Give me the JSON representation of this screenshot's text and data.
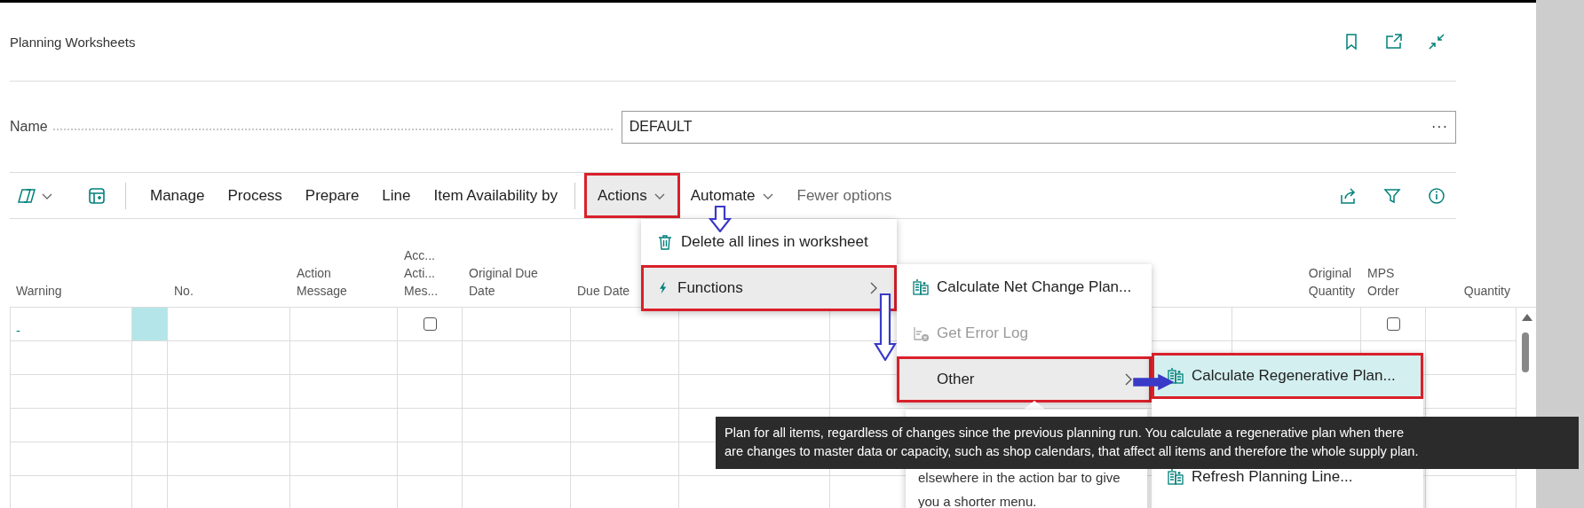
{
  "page": {
    "title": "Planning Worksheets"
  },
  "name_field": {
    "label": "Name",
    "value": "DEFAULT",
    "more": "···"
  },
  "toolbar": {
    "groups": [
      "Manage",
      "Process",
      "Prepare",
      "Line",
      "Item Availability by"
    ],
    "menus": [
      {
        "label": "Actions",
        "selected": true,
        "marked": true
      },
      {
        "label": "Automate",
        "selected": false,
        "marked": false
      }
    ],
    "fewer": "Fewer options"
  },
  "table": {
    "columns": [
      {
        "kind": "text",
        "label": "Warning"
      },
      {
        "kind": "marker"
      },
      {
        "kind": "text",
        "label": "No."
      },
      {
        "kind": "text",
        "label": "Action\nMessage"
      },
      {
        "kind": "text",
        "label": "Acc...\nActi...\nMes..."
      },
      {
        "kind": "text",
        "label": "Original Due\nDate"
      },
      {
        "kind": "text",
        "label": "Due Date"
      },
      {
        "kind": "blank"
      },
      {
        "kind": "blank"
      },
      {
        "kind": "number",
        "label": "Original\nQuantity"
      },
      {
        "kind": "text",
        "label": "MPS\nOrder"
      },
      {
        "kind": "number",
        "label": "Quantity"
      }
    ],
    "rows": [
      {
        "selected": true,
        "warning": "-",
        "accept_action_message": false,
        "mps_order": false
      }
    ]
  },
  "actions_menu": {
    "items": [
      {
        "kind": "command",
        "label": "Delete all lines in worksheet",
        "selected": false,
        "marked": false
      },
      {
        "kind": "submenu",
        "label": "Functions",
        "selected": true,
        "marked": true
      }
    ]
  },
  "functions_menu": {
    "items": [
      {
        "kind": "command",
        "label": "Calculate Net Change Plan...",
        "disabled": false,
        "selected": false,
        "marked": false
      },
      {
        "kind": "command",
        "label": "Get Error Log",
        "disabled": true,
        "selected": false,
        "marked": false
      },
      {
        "kind": "submenu",
        "label": "Other",
        "disabled": false,
        "selected": true,
        "marked": true
      }
    ]
  },
  "other_menu": {
    "items": [
      {
        "kind": "command",
        "label": "Calculate Regenerative Plan...",
        "selected": true,
        "marked": true
      },
      {
        "kind": "hidden"
      },
      {
        "kind": "command",
        "label": "Refresh Planning Line...",
        "selected": false,
        "marked": false
      }
    ]
  },
  "teaching_tip": {
    "text": "elsewhere in the action bar to give\nyou a shorter menu."
  },
  "tooltip": {
    "text": "Plan for all items, regardless of changes since the previous planning run. You calculate a regenerative plan when there\nare changes to master data or capacity, such as shop calendars, that affect all items and therefore the whole supply plan."
  }
}
